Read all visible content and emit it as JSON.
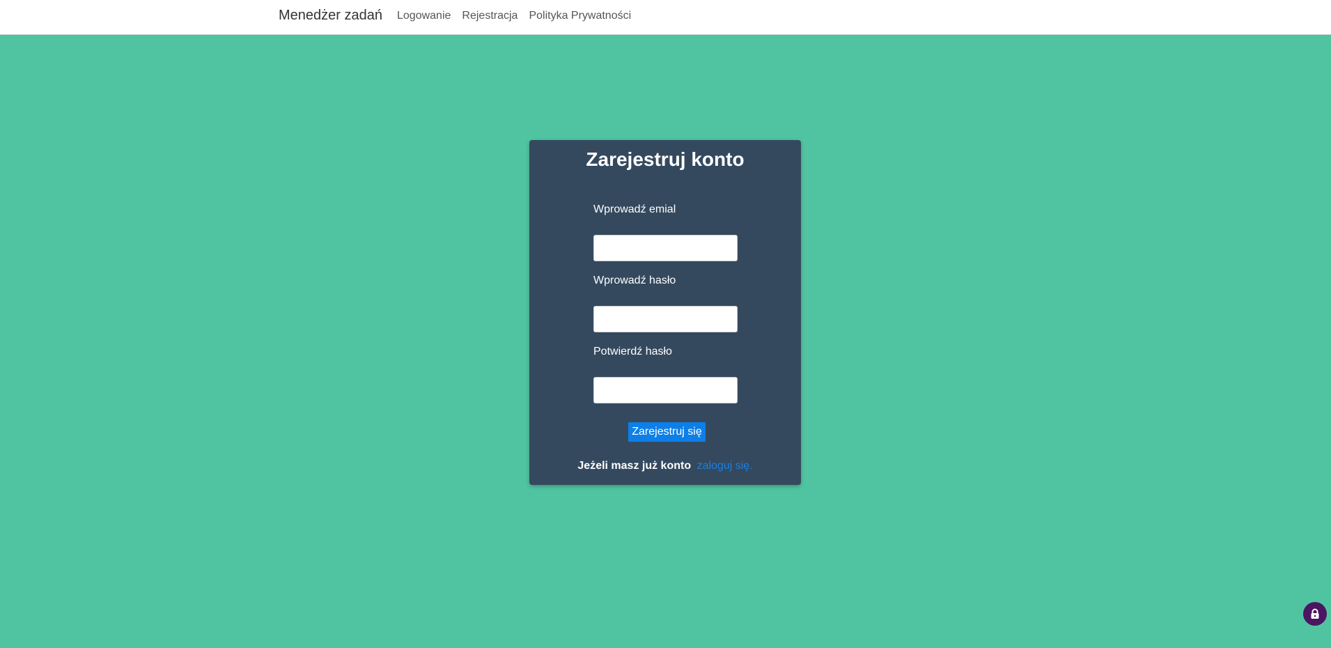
{
  "navbar": {
    "brand": "Menedżer zadań",
    "links": [
      "Logowanie",
      "Rejestracja",
      "Polityka Prywatności"
    ]
  },
  "form": {
    "title": "Zarejestruj konto",
    "email_label": "Wprowadź emial",
    "email_value": "",
    "password_label": "Wprowadź hasło",
    "password_value": "",
    "confirm_label": "Potwierdź hasło",
    "confirm_value": "",
    "submit_label": "Zarejestruj się",
    "footer_text": "Jeżeli masz już konto",
    "login_link": "zaloguj się."
  },
  "colors": {
    "background": "#50c4a1",
    "card": "#34495e",
    "button": "#0d7fe8",
    "link": "#1a7fe0",
    "badge": "#4b1561"
  },
  "icons": {
    "badge_icon": "lock-icon"
  }
}
